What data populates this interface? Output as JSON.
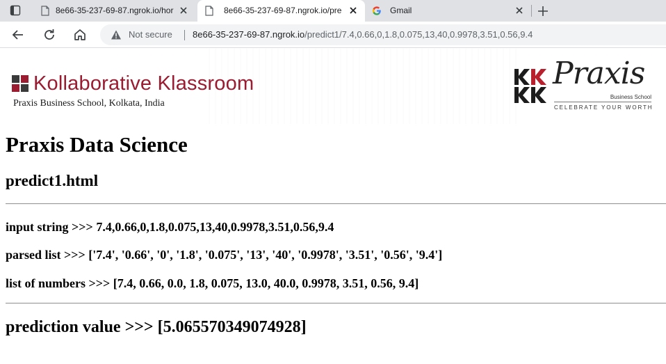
{
  "browser": {
    "tabs": [
      {
        "title": "8e66-35-237-69-87.ngrok.io/hor",
        "icon": "page-icon",
        "active": false
      },
      {
        "title": "8e66-35-237-69-87.ngrok.io/pre",
        "icon": "page-icon",
        "active": true
      },
      {
        "title": "Gmail",
        "icon": "google-icon",
        "active": false
      }
    ],
    "address": {
      "security_label": "Not secure",
      "host": "8e66-35-237-69-87.ngrok.io",
      "path": "/predict1/7.4,0.66,0,1.8,0.075,13,40,0.9978,3.51,0.56,9.4"
    }
  },
  "banner": {
    "title": "Kollaborative Klassroom",
    "subtitle": "Praxis Business School, Kolkata, India",
    "brand_color": "#9b1b30",
    "partner_logo": {
      "wordmark": "Praxis",
      "unit": "Business School",
      "tagline": "CELEBRATE YOUR WORTH"
    }
  },
  "content": {
    "site_title": "Praxis Data Science",
    "page_name": "predict1.html",
    "input_label": "input string >>> ",
    "input_value": "7.4,0.66,0,1.8,0.075,13,40,0.9978,3.51,0.56,9.4",
    "parsed_label": "parsed list >>> ",
    "parsed_value": "['7.4', '0.66', '0', '1.8', '0.075', '13', '40', '0.9978', '3.51', '0.56', '9.4']",
    "numbers_label": "list of numbers >>> ",
    "numbers_value": "[7.4, 0.66, 0.0, 1.8, 0.075, 13.0, 40.0, 0.9978, 3.51, 0.56, 9.4]",
    "prediction_label": "prediction value >>> ",
    "prediction_value": "[5.065570349074928]"
  }
}
